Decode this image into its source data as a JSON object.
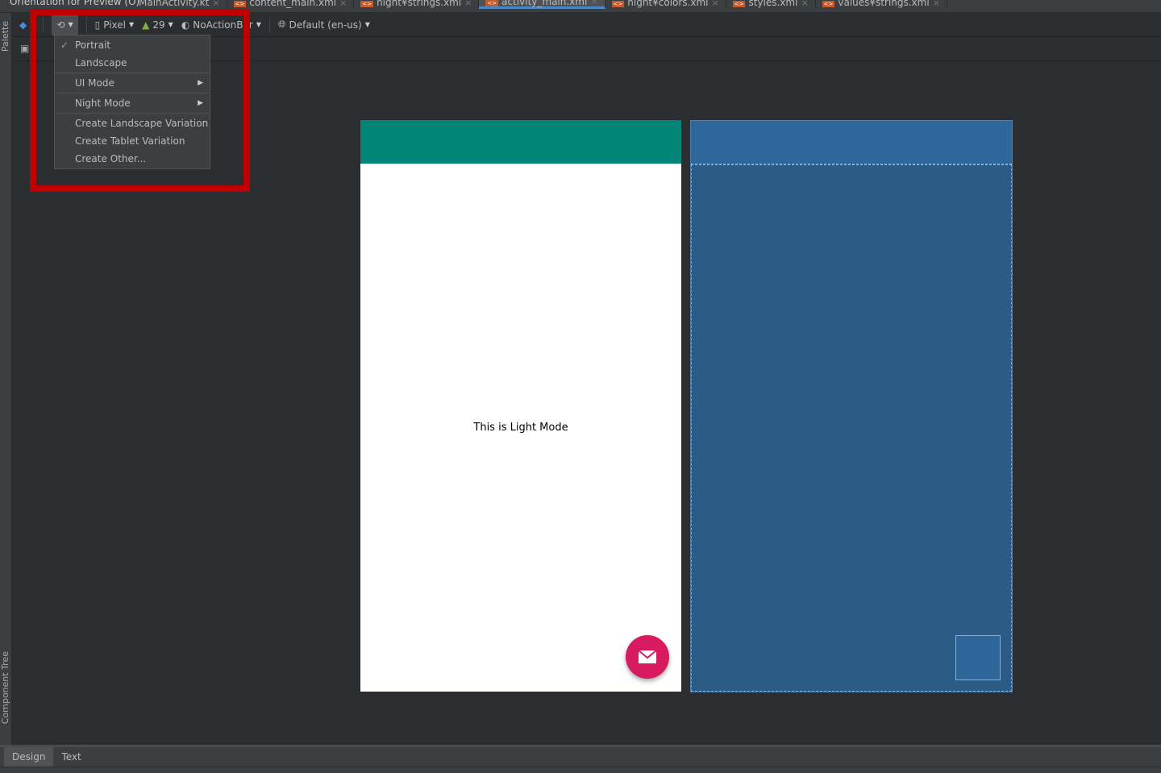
{
  "tooltip": "Orientation for Preview (O)",
  "tabs": [
    {
      "label": "MainActivity.kt"
    },
    {
      "label": "content_main.xml"
    },
    {
      "label": "night¥strings.xml"
    },
    {
      "label": "activity_main.xml",
      "active": true
    },
    {
      "label": "night¥colors.xml"
    },
    {
      "label": "styles.xml"
    },
    {
      "label": "values¥strings.xml"
    }
  ],
  "toolbar": {
    "device": "Pixel",
    "api": "29",
    "theme": "NoActionBar",
    "locale": "Default (en-us)"
  },
  "menu": {
    "items": [
      "Portrait",
      "Landscape",
      "UI Mode",
      "Night Mode",
      "Create Landscape Variation",
      "Create Tablet Variation",
      "Create Other..."
    ],
    "checked": "Portrait"
  },
  "side": {
    "palette": "Palette",
    "component_tree": "Component Tree"
  },
  "preview": {
    "text": "This is Light Mode",
    "appbar_color": "#008577",
    "fab_color": "#D81B60"
  },
  "bottom_tabs": [
    "Design",
    "Text"
  ],
  "highlight_color": "#C00000"
}
